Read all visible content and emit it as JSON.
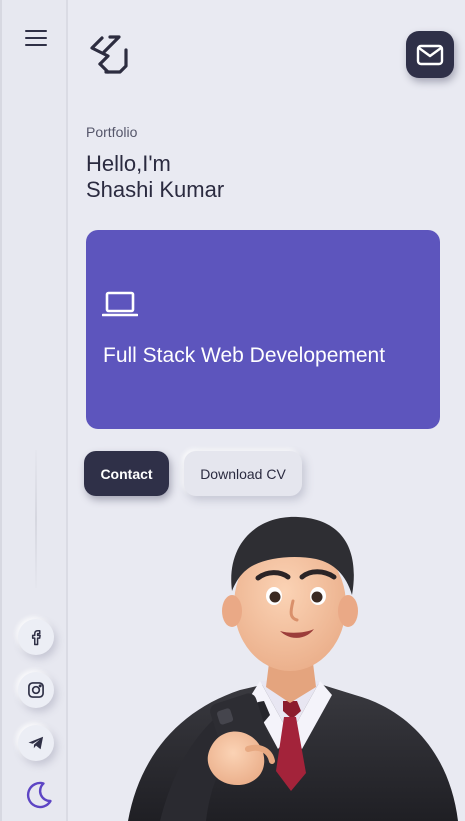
{
  "sidebar": {
    "menu_icon": "hamburger-menu-icon",
    "socials": [
      {
        "name": "facebook",
        "icon": "facebook-icon"
      },
      {
        "name": "instagram",
        "icon": "instagram-icon"
      },
      {
        "name": "telegram",
        "icon": "telegram-icon"
      }
    ],
    "theme_icon": "moon-icon"
  },
  "header": {
    "logo_icon": "sk-logo",
    "mail_icon": "mail-icon"
  },
  "hero": {
    "eyebrow": "Portfolio",
    "greeting_line1": "Hello,I'm",
    "greeting_line2": "Shashi Kumar"
  },
  "card": {
    "icon": "laptop-icon",
    "title": "Full Stack Web Developement"
  },
  "actions": {
    "contact_label": "Contact",
    "cv_label": "Download CV"
  },
  "colors": {
    "background": "#e9eaf2",
    "dark": "#2f3048",
    "accent": "#5d55bd",
    "moon": "#5d45c4"
  },
  "illustration": "3d-avatar-businessman-with-phone"
}
